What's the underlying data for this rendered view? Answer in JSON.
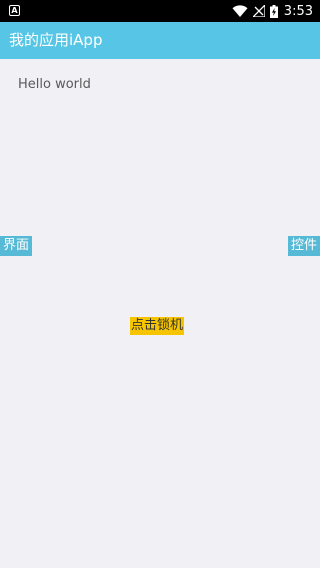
{
  "status_bar": {
    "notification_icon": "A",
    "icons": [
      "wifi-icon",
      "signal-icon",
      "battery-charging-icon"
    ],
    "time": "3:53"
  },
  "app_bar": {
    "title": "我的应用iApp",
    "color": "#56c5e6"
  },
  "main": {
    "hello_text": "Hello world",
    "left_button": "界面",
    "right_button": "控件",
    "lock_button": "点击锁机",
    "lock_button_color": "#f7c500",
    "side_button_color": "#56b9d6"
  }
}
